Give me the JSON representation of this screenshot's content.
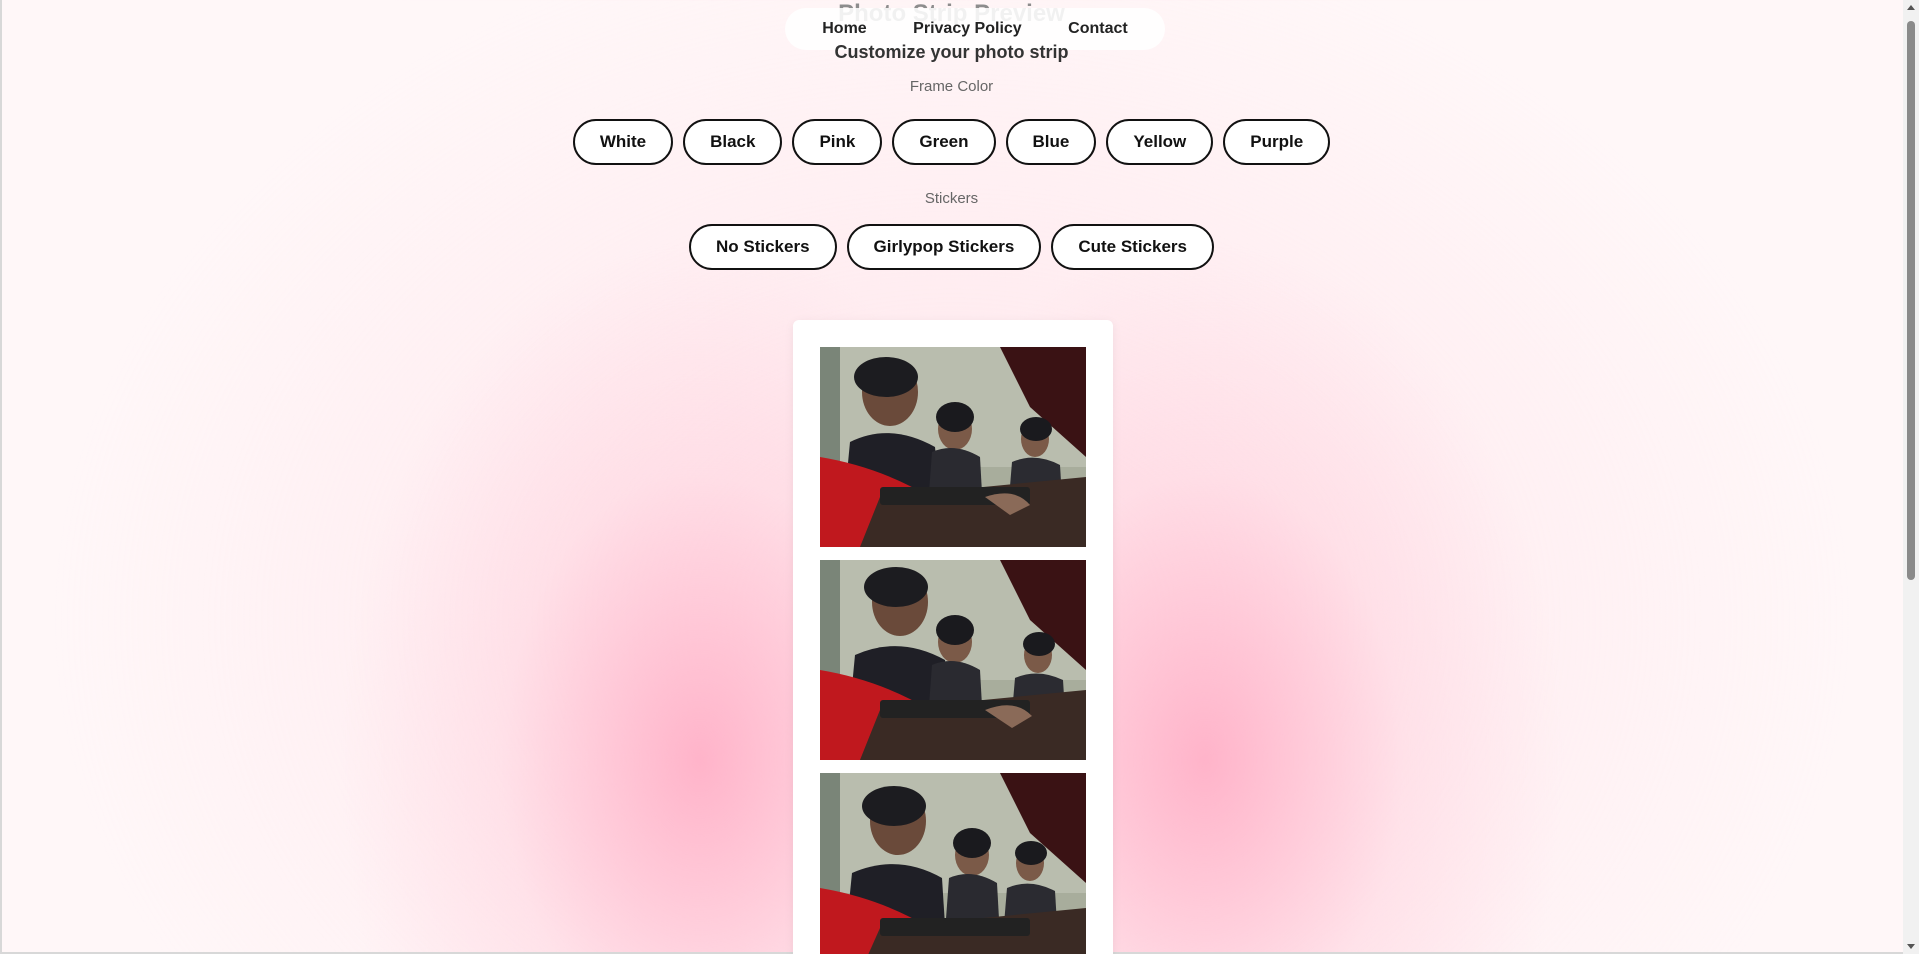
{
  "page": {
    "title": "Photo Strip Preview",
    "subtitle": "Customize your photo strip"
  },
  "nav": {
    "items": [
      "Home",
      "Privacy Policy",
      "Contact"
    ]
  },
  "frame_color": {
    "label": "Frame Color",
    "options": [
      "White",
      "Black",
      "Pink",
      "Green",
      "Blue",
      "Yellow",
      "Purple"
    ]
  },
  "stickers": {
    "label": "Stickers",
    "options": [
      "No Stickers",
      "Girlypop Stickers",
      "Cute Stickers"
    ]
  },
  "colors": {
    "background": "#fff7f8",
    "glow": "#ffaac3",
    "button_border": "#111111",
    "strip": "#ffffff"
  }
}
